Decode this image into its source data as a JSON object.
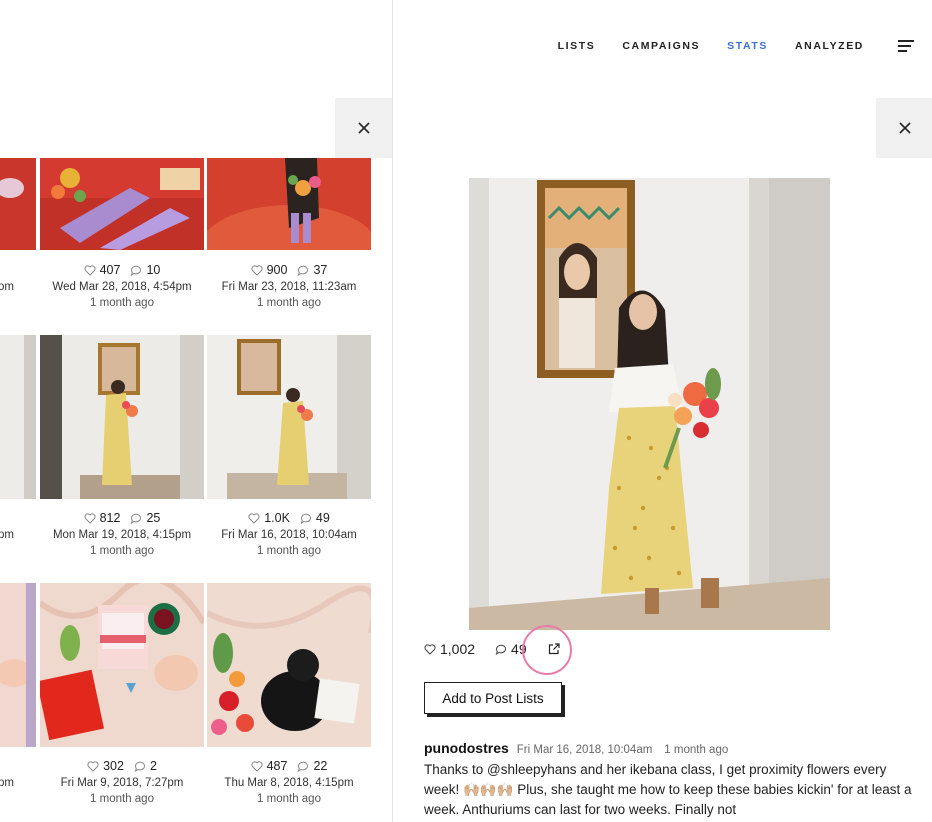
{
  "nav": {
    "items": [
      "LISTS",
      "CAMPAIGNS",
      "STATS",
      "ANALYZED"
    ],
    "active": "STATS"
  },
  "grid": {
    "rows": [
      {
        "partial": {
          "date_fragment": "om"
        },
        "tiles": [
          {
            "likes": "407",
            "comments": "10",
            "date": "Wed Mar 28, 2018, 4:54pm",
            "ago": "1 month ago"
          },
          {
            "likes": "900",
            "comments": "37",
            "date": "Fri Mar 23, 2018, 11:23am",
            "ago": "1 month ago"
          }
        ]
      },
      {
        "partial": {
          "date_fragment": "pm"
        },
        "tiles": [
          {
            "likes": "812",
            "comments": "25",
            "date": "Mon Mar 19, 2018, 4:15pm",
            "ago": "1 month ago"
          },
          {
            "likes": "1.0K",
            "comments": "49",
            "date": "Fri Mar 16, 2018, 10:04am",
            "ago": "1 month ago"
          }
        ]
      },
      {
        "partial": {
          "date_fragment": "pm"
        },
        "tiles": [
          {
            "likes": "302",
            "comments": "2",
            "date": "Fri Mar 9, 2018, 7:27pm",
            "ago": "1 month ago"
          },
          {
            "likes": "487",
            "comments": "22",
            "date": "Thu Mar 8, 2018, 4:15pm",
            "ago": "1 month ago"
          }
        ]
      }
    ]
  },
  "post": {
    "likes": "1,002",
    "comments": "49",
    "add_button": "Add to Post Lists",
    "username": "punodostres",
    "date": "Fri Mar 16, 2018, 10:04am",
    "ago": "1 month ago",
    "caption": "Thanks to @shleepyhans and her ikebana class, I get proximity flowers every week! 🙌🏼🙌🏼🙌🏼 Plus, she taught me how to keep these babies kickin' for at least a week. Anthuriums can last for two weeks. Finally not"
  },
  "colors": {
    "accent": "#3d6fd6",
    "highlight_ring": "#e87ba8"
  },
  "icons": [
    "close-icon",
    "menu-icon",
    "heart-icon",
    "comment-icon",
    "external-link-icon"
  ]
}
